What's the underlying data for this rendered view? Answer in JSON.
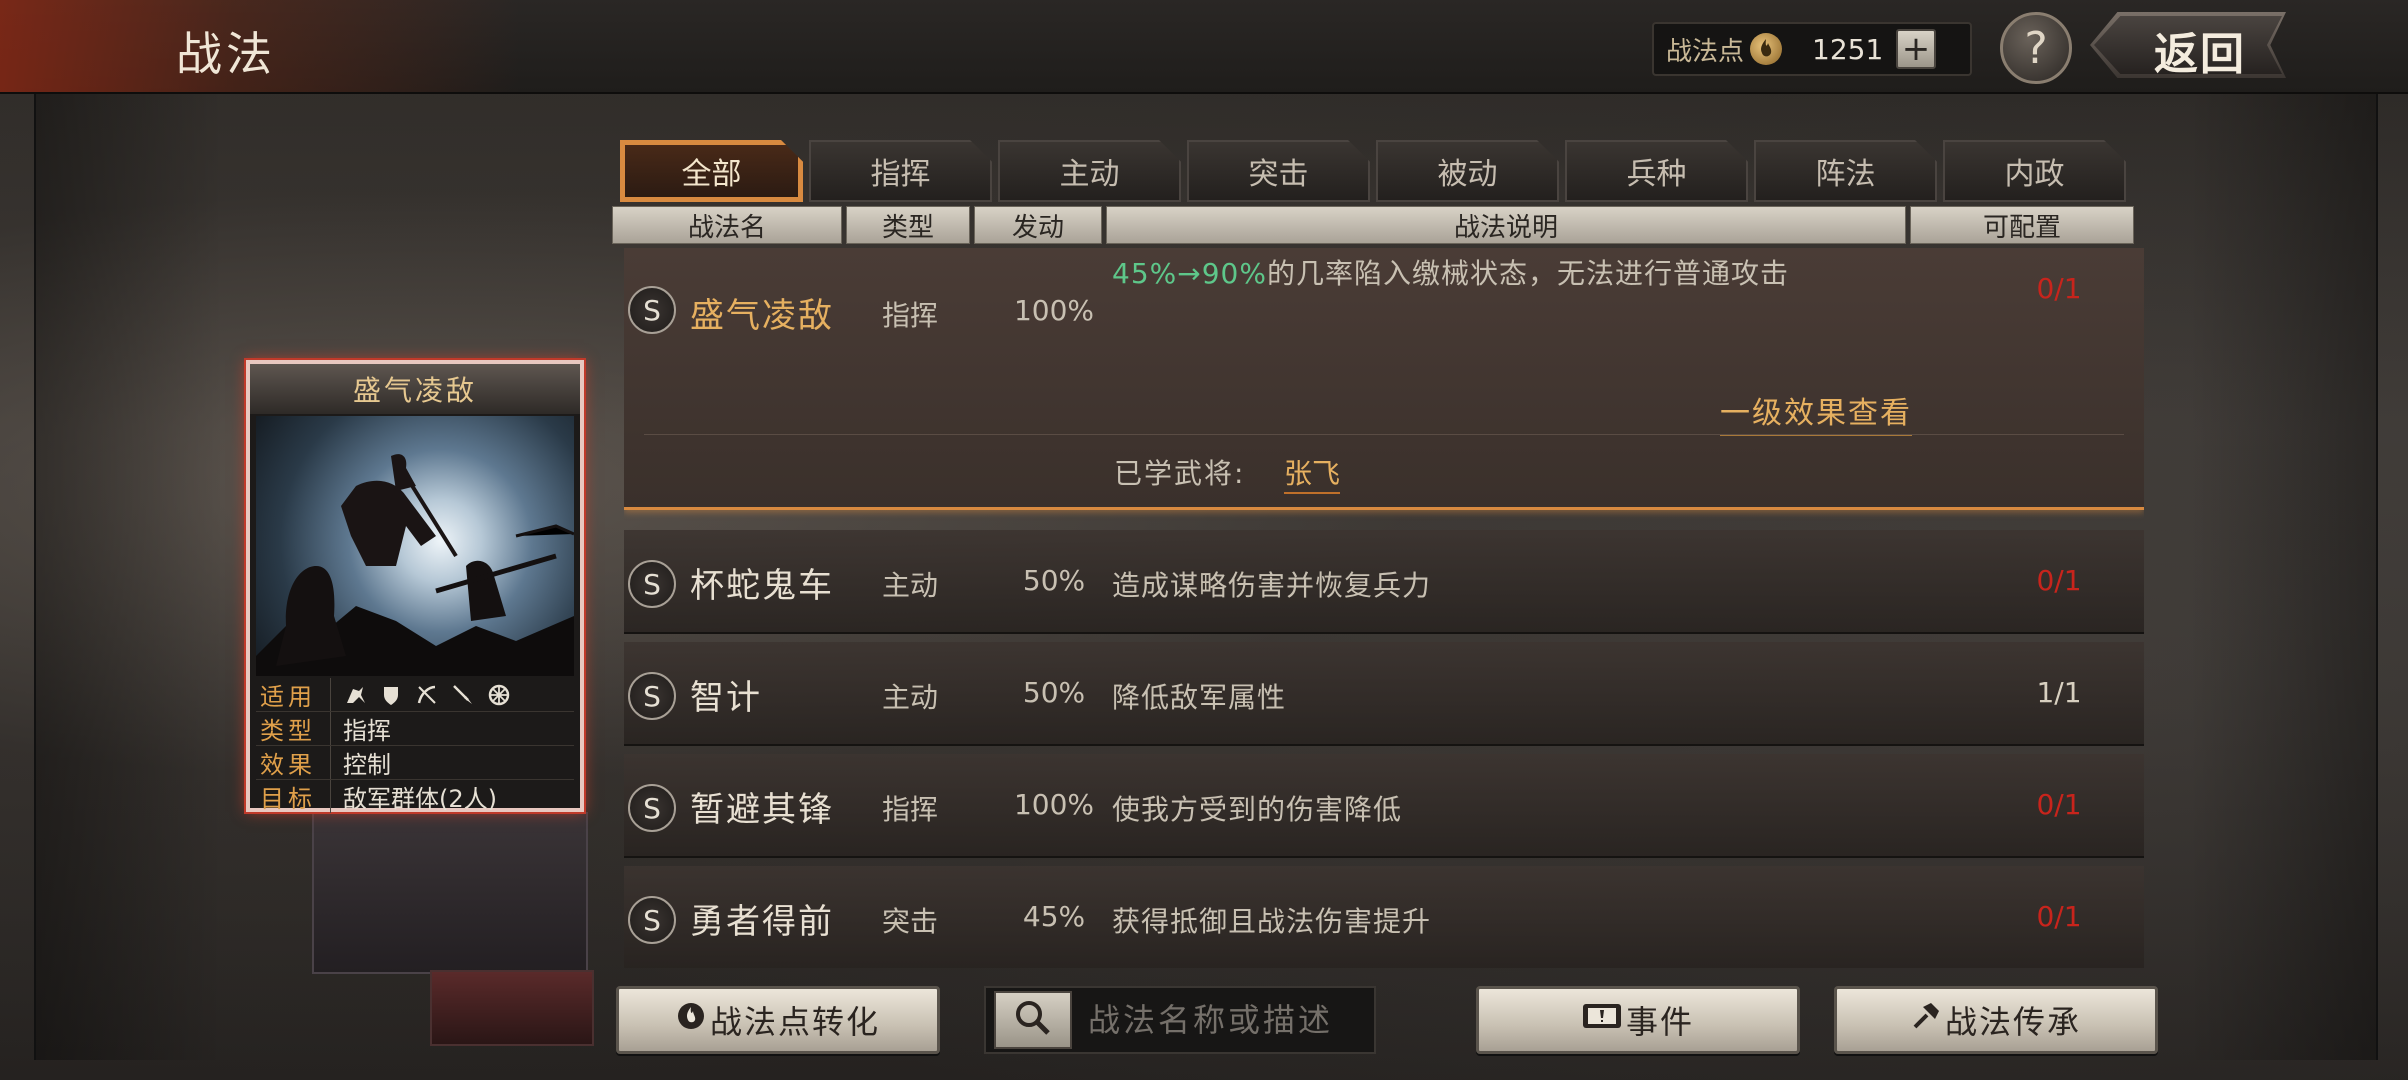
{
  "header": {
    "title": "战法",
    "points_label": "战法点",
    "points_value": "1251",
    "plus_label": "+",
    "help_label": "?",
    "back_label": "返回"
  },
  "tabs": [
    {
      "label": "全部",
      "active": true
    },
    {
      "label": "指挥",
      "active": false
    },
    {
      "label": "主动",
      "active": false
    },
    {
      "label": "突击",
      "active": false
    },
    {
      "label": "被动",
      "active": false
    },
    {
      "label": "兵种",
      "active": false
    },
    {
      "label": "阵法",
      "active": false
    },
    {
      "label": "内政",
      "active": false
    }
  ],
  "columns": {
    "name": "战法名",
    "type": "类型",
    "rate": "发动",
    "desc": "战法说明",
    "config": "可配置"
  },
  "expanded": {
    "grade": "S",
    "name": "盛气凌敌",
    "type": "指挥",
    "rate": "100%",
    "desc_highlight": "45%→90%",
    "desc_rest": "的几率陷入缴械状态，无法进行普通攻击",
    "config": "0/1",
    "level_link": "一级效果查看",
    "learned_label": "已学武将:",
    "learned_general": "张飞"
  },
  "rows": [
    {
      "grade": "S",
      "name": "杯蛇鬼车",
      "type": "主动",
      "rate": "50%",
      "desc": "造成谋略伤害并恢复兵力",
      "config": "0/1"
    },
    {
      "grade": "S",
      "name": "智计",
      "type": "主动",
      "rate": "50%",
      "desc": "降低敌军属性",
      "config": "1/1"
    },
    {
      "grade": "S",
      "name": "暂避其锋",
      "type": "指挥",
      "rate": "100%",
      "desc": "使我方受到的伤害降低",
      "config": "0/1"
    },
    {
      "grade": "S",
      "name": "勇者得前",
      "type": "突击",
      "rate": "45%",
      "desc": "获得抵御且战法伤害提升",
      "config": "0/1"
    }
  ],
  "card": {
    "title": "盛气凌敌",
    "applies_key": "适用",
    "type_key": "类型",
    "type_val": "指挥",
    "effect_key": "效果",
    "effect_val": "控制",
    "target_key": "目标",
    "target_val": "敌军群体(2人)",
    "troop_icons": [
      "cavalry-icon",
      "shield-icon",
      "bow-icon",
      "spear-icon",
      "chariot-icon"
    ]
  },
  "footer": {
    "convert_label": "战法点转化",
    "search_placeholder": "战法名称或描述",
    "event_label": "事件",
    "inherit_label": "战法传承"
  },
  "colors": {
    "accent_orange": "#d88a40",
    "gold_text": "#e6b060",
    "config_red": "#c8241c",
    "desc_green": "#5ec78a"
  }
}
